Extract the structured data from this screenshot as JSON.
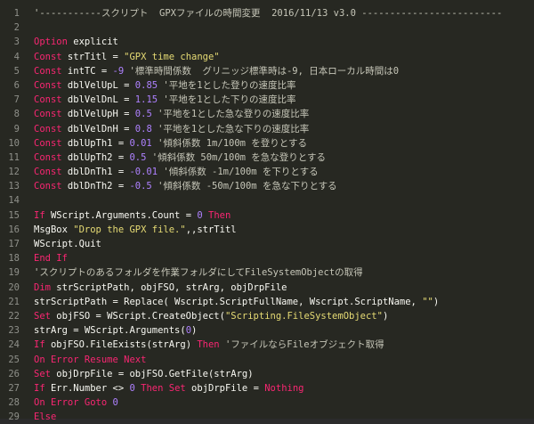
{
  "lines": [
    {
      "n": "1",
      "t": [
        {
          "c": "cm",
          "s": "'-----------スクリプト  GPXファイルの時間変更  2016/11/13 v3.0 -------------------------"
        }
      ]
    },
    {
      "n": "2",
      "t": []
    },
    {
      "n": "3",
      "t": [
        {
          "c": "kw",
          "s": "Option"
        },
        {
          "c": "id",
          "s": " explicit"
        }
      ]
    },
    {
      "n": "4",
      "t": [
        {
          "c": "kw",
          "s": "Const"
        },
        {
          "c": "id",
          "s": " strTitl = "
        },
        {
          "c": "str",
          "s": "\"GPX time change\""
        }
      ]
    },
    {
      "n": "5",
      "t": [
        {
          "c": "kw",
          "s": "Const"
        },
        {
          "c": "id",
          "s": " intTC = "
        },
        {
          "c": "num",
          "s": "-9"
        },
        {
          "c": "cm",
          "s": " '標準時間係数  グリニッジ標準時は-9, 日本ローカル時間は0"
        }
      ]
    },
    {
      "n": "6",
      "t": [
        {
          "c": "kw",
          "s": "Const"
        },
        {
          "c": "id",
          "s": " dblVelUpL = "
        },
        {
          "c": "num",
          "s": "0.85"
        },
        {
          "c": "cm",
          "s": " '平地を1とした登りの速度比率"
        }
      ]
    },
    {
      "n": "7",
      "t": [
        {
          "c": "kw",
          "s": "Const"
        },
        {
          "c": "id",
          "s": " dblVelDnL = "
        },
        {
          "c": "num",
          "s": "1.15"
        },
        {
          "c": "cm",
          "s": " '平地を1とした下りの速度比率"
        }
      ]
    },
    {
      "n": "8",
      "t": [
        {
          "c": "kw",
          "s": "Const"
        },
        {
          "c": "id",
          "s": " dblVelUpH = "
        },
        {
          "c": "num",
          "s": "0.5"
        },
        {
          "c": "cm",
          "s": " '平地を1とした急な登りの速度比率"
        }
      ]
    },
    {
      "n": "9",
      "t": [
        {
          "c": "kw",
          "s": "Const"
        },
        {
          "c": "id",
          "s": " dblVelDnH = "
        },
        {
          "c": "num",
          "s": "0.8"
        },
        {
          "c": "cm",
          "s": " '平地を1とした急な下りの速度比率"
        }
      ]
    },
    {
      "n": "10",
      "t": [
        {
          "c": "kw",
          "s": "Const"
        },
        {
          "c": "id",
          "s": " dblUpTh1 = "
        },
        {
          "c": "num",
          "s": "0.01"
        },
        {
          "c": "cm",
          "s": " '傾斜係数 1m/100m を登りとする"
        }
      ]
    },
    {
      "n": "11",
      "t": [
        {
          "c": "kw",
          "s": "Const"
        },
        {
          "c": "id",
          "s": " dblUpTh2 = "
        },
        {
          "c": "num",
          "s": "0.5"
        },
        {
          "c": "cm",
          "s": " '傾斜係数 50m/100m を急な登りとする"
        }
      ]
    },
    {
      "n": "12",
      "t": [
        {
          "c": "kw",
          "s": "Const"
        },
        {
          "c": "id",
          "s": " dblDnTh1 = "
        },
        {
          "c": "num",
          "s": "-0.01"
        },
        {
          "c": "cm",
          "s": " '傾斜係数 -1m/100m を下りとする"
        }
      ]
    },
    {
      "n": "13",
      "t": [
        {
          "c": "kw",
          "s": "Const"
        },
        {
          "c": "id",
          "s": " dblDnTh2 = "
        },
        {
          "c": "num",
          "s": "-0.5"
        },
        {
          "c": "cm",
          "s": " '傾斜係数 -50m/100m を急な下りとする"
        }
      ]
    },
    {
      "n": "14",
      "t": []
    },
    {
      "n": "15",
      "t": [
        {
          "c": "kw",
          "s": "If"
        },
        {
          "c": "id",
          "s": " WScript.Arguments.Count = "
        },
        {
          "c": "num",
          "s": "0"
        },
        {
          "c": "kw",
          "s": " Then"
        }
      ]
    },
    {
      "n": "16",
      "t": [
        {
          "c": "id",
          "s": "MsgBox "
        },
        {
          "c": "str",
          "s": "\"Drop the GPX file.\""
        },
        {
          "c": "id",
          "s": ",,strTitl"
        }
      ]
    },
    {
      "n": "17",
      "t": [
        {
          "c": "id",
          "s": "WScript.Quit"
        }
      ]
    },
    {
      "n": "18",
      "t": [
        {
          "c": "kw",
          "s": "End If"
        }
      ]
    },
    {
      "n": "19",
      "t": [
        {
          "c": "cm",
          "s": "'スクリプトのあるフォルダを作業フォルダにしてFileSystemObjectの取得"
        }
      ]
    },
    {
      "n": "20",
      "t": [
        {
          "c": "kw",
          "s": "Dim"
        },
        {
          "c": "id",
          "s": " strScriptPath, objFSO, strArg, objDrpFile"
        }
      ]
    },
    {
      "n": "21",
      "t": [
        {
          "c": "id",
          "s": "strScriptPath = Replace( Wscript.ScriptFullName, Wscript.ScriptName, "
        },
        {
          "c": "str",
          "s": "\"\""
        },
        {
          "c": "id",
          "s": ")"
        }
      ]
    },
    {
      "n": "22",
      "t": [
        {
          "c": "kw",
          "s": "Set"
        },
        {
          "c": "id",
          "s": " objFSO = WScript.CreateObject("
        },
        {
          "c": "str",
          "s": "\"Scripting.FileSystemObject\""
        },
        {
          "c": "id",
          "s": ")"
        }
      ]
    },
    {
      "n": "23",
      "t": [
        {
          "c": "id",
          "s": "strArg = WScript.Arguments("
        },
        {
          "c": "num",
          "s": "0"
        },
        {
          "c": "id",
          "s": ")"
        }
      ]
    },
    {
      "n": "24",
      "t": [
        {
          "c": "kw",
          "s": "If"
        },
        {
          "c": "id",
          "s": " objFSO.FileExists(strArg) "
        },
        {
          "c": "kw",
          "s": "Then"
        },
        {
          "c": "cm",
          "s": " 'ファイルならFileオブジェクト取得"
        }
      ]
    },
    {
      "n": "25",
      "t": [
        {
          "c": "kw",
          "s": "On Error Resume Next"
        }
      ]
    },
    {
      "n": "26",
      "t": [
        {
          "c": "kw",
          "s": "Set"
        },
        {
          "c": "id",
          "s": " objDrpFile = objFSO.GetFile(strArg)"
        }
      ]
    },
    {
      "n": "27",
      "t": [
        {
          "c": "kw",
          "s": "If"
        },
        {
          "c": "id",
          "s": " Err.Number <> "
        },
        {
          "c": "num",
          "s": "0"
        },
        {
          "c": "kw",
          "s": " Then Set"
        },
        {
          "c": "id",
          "s": " objDrpFile = "
        },
        {
          "c": "kw",
          "s": "Nothing"
        }
      ]
    },
    {
      "n": "28",
      "t": [
        {
          "c": "kw",
          "s": "On Error Goto"
        },
        {
          "c": "num",
          "s": " 0"
        }
      ]
    },
    {
      "n": "29",
      "t": [
        {
          "c": "kw",
          "s": "Else"
        }
      ]
    }
  ]
}
